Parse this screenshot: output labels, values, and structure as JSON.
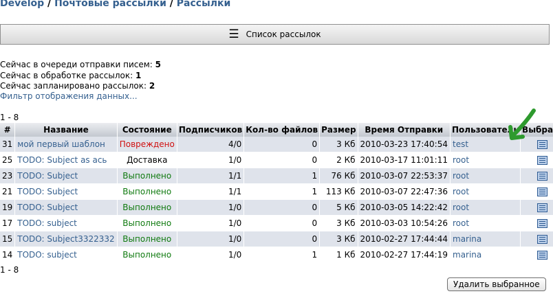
{
  "breadcrumb": {
    "part1": "Develop",
    "sep1": " / ",
    "part2": "Почтовые рассылки",
    "sep2": " / ",
    "part3": "Рассылки"
  },
  "toolbar": {
    "icon": "menu-icon",
    "label": "Список рассылок"
  },
  "stats": {
    "queue_label": "Сейчас в очереди отправки писем: ",
    "queue_value": "5",
    "processing_label": "Сейчас в обработке рассылок: ",
    "processing_value": "1",
    "scheduled_label": "Сейчас запланировано рассылок: ",
    "scheduled_value": "2"
  },
  "filter_link": "Фильтр отображения данных...",
  "pager": {
    "top": "1 - 8",
    "bottom": "1 - 8"
  },
  "table": {
    "headers": {
      "num": "#",
      "name": "Название",
      "state": "Состояние",
      "subscribers": "Подписчиков",
      "files": "Кол-во файлов",
      "size": "Размер",
      "time": "Время Отправки",
      "user": "Пользователь",
      "select": "Выбрать"
    },
    "rows": [
      {
        "id": "31",
        "name": "мой первый шаблон",
        "state": "Повреждено",
        "state_color": "#d01010",
        "subs": "4/0",
        "files": "0",
        "size": "3 Кб",
        "time": "2010-03-23 17:40:54",
        "user": "test"
      },
      {
        "id": "25",
        "name": "TODO: Subject as ась",
        "state": "Доставка",
        "state_color": "#000000",
        "subs": "1/0",
        "files": "0",
        "size": "2 Кб",
        "time": "2010-03-17 11:01:11",
        "user": "root"
      },
      {
        "id": "23",
        "name": "TODO: Subject",
        "state": "Выполнено",
        "state_color": "#0f7a0f",
        "subs": "1/1",
        "files": "1",
        "size": "76 Кб",
        "time": "2010-03-07 22:53:37",
        "user": "root"
      },
      {
        "id": "21",
        "name": "TODO: Subject",
        "state": "Выполнено",
        "state_color": "#0f7a0f",
        "subs": "1/1",
        "files": "1",
        "size": "113 Кб",
        "time": "2010-03-07 22:47:36",
        "user": "root"
      },
      {
        "id": "19",
        "name": "TODO: Subject",
        "state": "Выполнено",
        "state_color": "#0f7a0f",
        "subs": "1/0",
        "files": "0",
        "size": "5 Кб",
        "time": "2010-03-05 14:22:42",
        "user": "root"
      },
      {
        "id": "17",
        "name": "TODO: subject",
        "state": "Выполнено",
        "state_color": "#0f7a0f",
        "subs": "1/0",
        "files": "0",
        "size": "3 Кб",
        "time": "2010-03-03 10:54:26",
        "user": "root"
      },
      {
        "id": "15",
        "name": "TODO: Subject3322332",
        "state": "Выполнено",
        "state_color": "#0f7a0f",
        "subs": "1/0",
        "files": "0",
        "size": "3 Кб",
        "time": "2010-02-27 17:44:44",
        "user": "marina"
      },
      {
        "id": "14",
        "name": "TODO: subject",
        "state": "Выполнено",
        "state_color": "#0f7a0f",
        "subs": "1/0",
        "files": "1",
        "size": "1 Кб",
        "time": "2010-02-27 17:44:19",
        "user": "marina"
      }
    ]
  },
  "delete_button": "Удалить выбранное",
  "colors": {
    "link": "#35608f",
    "arrow": "#2e9a2e",
    "row_alt": "#dfe3eb"
  }
}
